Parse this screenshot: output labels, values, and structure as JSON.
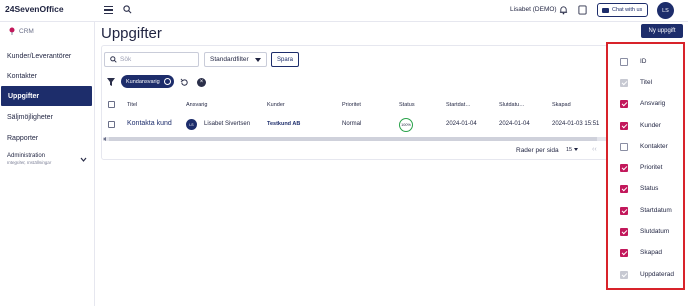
{
  "topbar": {
    "logo": "24SevenOffice",
    "user": "Lisabet (DEMO)",
    "chat_label": "Chat with us",
    "avatar_initials": "LS"
  },
  "sidebar": {
    "module": "CRM",
    "items": [
      {
        "label": "Kunder/Leverantörer"
      },
      {
        "label": "Kontakter"
      },
      {
        "label": "Uppgifter"
      },
      {
        "label": "Säljmöjligheter"
      },
      {
        "label": "Rapporter"
      }
    ],
    "admin_label": "Administration",
    "admin_sub": "Integritet, Inställningar"
  },
  "page": {
    "title": "Uppgifter",
    "new_button": "Ny uppgift",
    "search_placeholder": "Sök",
    "filter_select": "Standardfilter",
    "save_button": "Spara",
    "active_chip": "Kundansvarig"
  },
  "table": {
    "columns": [
      "Titel",
      "Ansvarig",
      "Kunder",
      "Prioritet",
      "Status",
      "Startdat…",
      "Slutdatu…",
      "Skapad"
    ],
    "rows": [
      {
        "title": "Kontakta kund",
        "owner_initials": "LS",
        "owner": "Lisabet Sivertsen",
        "customer": "Testkund AB",
        "priority": "Normal",
        "status": "100%",
        "start": "2024-01-04",
        "end": "2024-01-04",
        "created": "2024-01-03 15:51"
      }
    ],
    "footer": {
      "rows_per_page_label": "Rader per sida",
      "rows_per_page_value": "15",
      "prev_symbol": "‹‹"
    }
  },
  "column_panel": {
    "items": [
      {
        "label": "ID",
        "state": "unchecked"
      },
      {
        "label": "Titel",
        "state": "disabled"
      },
      {
        "label": "Ansvarig",
        "state": "checked"
      },
      {
        "label": "Kunder",
        "state": "checked"
      },
      {
        "label": "Kontakter",
        "state": "unchecked"
      },
      {
        "label": "Prioritet",
        "state": "checked"
      },
      {
        "label": "Status",
        "state": "checked"
      },
      {
        "label": "Startdatum",
        "state": "checked"
      },
      {
        "label": "Slutdatum",
        "state": "checked"
      },
      {
        "label": "Skapad",
        "state": "checked"
      },
      {
        "label": "Uppdaterad",
        "state": "disabled"
      }
    ]
  },
  "colors": {
    "brand": "#1d2d6b",
    "checkbox_checked": "#c2185b",
    "highlight": "#d8232a",
    "status_ring": "#2aa24a"
  }
}
